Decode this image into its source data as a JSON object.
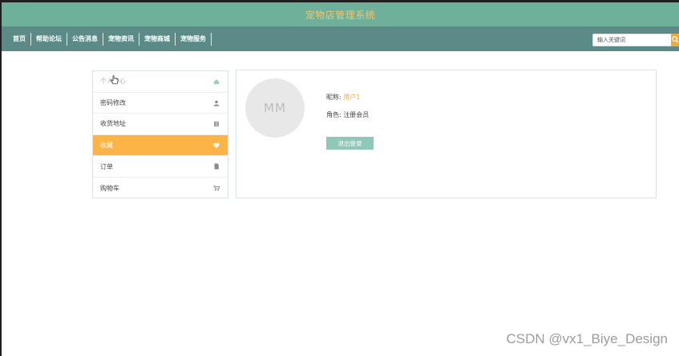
{
  "header": {
    "title": "宠物店管理系统"
  },
  "nav": {
    "items": [
      {
        "label": "首页"
      },
      {
        "label": "帮助论坛"
      },
      {
        "label": "公告消息"
      },
      {
        "label": "宠物资讯"
      },
      {
        "label": "宠物商城"
      },
      {
        "label": "宠物服务"
      }
    ]
  },
  "search": {
    "placeholder": "输入关键词",
    "value": ""
  },
  "sidebar": {
    "items": [
      {
        "label": "个人中心",
        "icon": "house-icon",
        "state": "hover"
      },
      {
        "label": "密码修改",
        "icon": "user-icon"
      },
      {
        "label": "收货地址",
        "icon": "address-book-icon"
      },
      {
        "label": "收藏",
        "icon": "heart-icon",
        "active": true
      },
      {
        "label": "订单",
        "icon": "file-icon"
      },
      {
        "label": "购物车",
        "icon": "cart-icon"
      }
    ]
  },
  "profile": {
    "avatar_text": "MM",
    "nickname_label": "昵称:",
    "nickname_value": "用户1",
    "role_label": "角色:",
    "role_value": "注册会员",
    "logout_label": "退出登录"
  },
  "colors": {
    "header_bg": "#6fb09b",
    "nav_bg": "#5b8a87",
    "accent_orange": "#fdb446",
    "title_color": "#f3c56b",
    "logout_button": "#8fc7b8"
  },
  "watermark": "CSDN @vx1_Biye_Design"
}
